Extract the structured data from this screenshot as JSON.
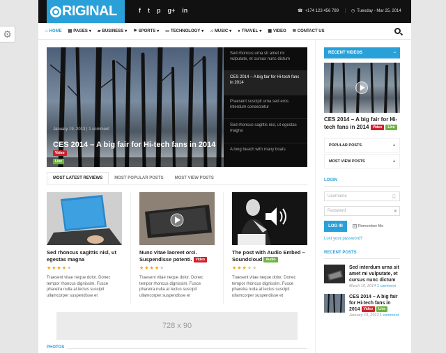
{
  "header": {
    "logo": "RIGINAL",
    "social": [
      "f",
      "t",
      "p",
      "g+",
      "in"
    ],
    "phone": "+174 123 456 789",
    "date": "Tuesday - Mar 25, 2014"
  },
  "nav": {
    "items": [
      {
        "label": "HOME",
        "icon": "home-icon"
      },
      {
        "label": "PAGES",
        "icon": "pages-icon"
      },
      {
        "label": "BUSINESS",
        "icon": "briefcase-icon"
      },
      {
        "label": "SPORTS",
        "icon": "flag-icon"
      },
      {
        "label": "TECHNOLOGY",
        "icon": "tech-icon"
      },
      {
        "label": "MUSIC",
        "icon": "music-icon"
      },
      {
        "label": "TRAVEL",
        "icon": "globe-icon"
      },
      {
        "label": "VIDEO",
        "icon": "film-icon"
      },
      {
        "label": "CONTACT US",
        "icon": "mail-icon"
      }
    ]
  },
  "hero": {
    "meta_date": "January 19, 2013",
    "meta_comments": "1 comment",
    "title": "CES 2014 – A big fair for Hi-tech fans in 2014",
    "badge_video": "Video",
    "badge_live": "Live",
    "list": [
      "Sed rhoncus urna sit amet mi vulputate, et cursus nunc dictum",
      "CES 2014 – A big fair for Hi-tech fans in 2014",
      "Praesent suscipit urna sed eros interdum consectetur",
      "Sed rhoncus sagittis nisl, ut egestas magna",
      "A long beach with many boats"
    ]
  },
  "tabs": [
    "MOST LATEST REVIEWS",
    "MOST POPULAR POSTS",
    "MOST VIEW POSTS"
  ],
  "articles": [
    {
      "title": "Sed rhoncus sagittis nisl, ut egestas magna",
      "rating": 4,
      "excerpt": "Traesent vitae neque dolor. Donec tempor rhoncus dignissim. Fusce pharetra nulla at lectus suscipit ullamcorper suspendisse et"
    },
    {
      "title": "Nunc vitae laoreet orci. Suspendisse potenti.",
      "badge": "Video",
      "rating": 4,
      "excerpt": "Traesent vitae neque dolor. Donec tempor rhoncus dignissim. Fusce pharetra nulla at lectus suscipit ullamcorper suspendisse et"
    },
    {
      "title": "The post with Audio Embed – Soundcloud",
      "badge": "Audio",
      "rating": 3,
      "excerpt": "Traesent vitae neque dolor. Donec tempor rhoncus dignissim. Fusce pharetra nulla at lectus suscipit ullamcorper suspendisse et"
    }
  ],
  "ad_label": "728 x 90",
  "bottom_heading": "PHOTOS",
  "sidebar": {
    "recent_videos_title": "RECENT VIDEOS",
    "recent_videos_toggle": "−",
    "video_title": "CES 2014 – A big fair for Hi-tech fans in 2014",
    "badge_video": "Video",
    "badge_live": "Live",
    "accordion": [
      {
        "label": "POPULAR POSTS",
        "toggle": "+"
      },
      {
        "label": "MOST VIEW POSTS",
        "toggle": "+"
      }
    ],
    "login_title": "LOGIN",
    "username_placeholder": "Username",
    "password_placeholder": "Password",
    "login_button": "LOG IN",
    "remember_label": "Remember Me",
    "lost_password": "Lost your password?",
    "recent_posts_title": "RECENT POSTS",
    "recent_posts": [
      {
        "title": "Sed interdum urna sit amet mi vulputate, et cursus nunc dictum",
        "date": "March 10, 2014",
        "comments": "1 comment"
      },
      {
        "title": "CES 2014 – A big fair for Hi-tech fans in 2014",
        "badge_video": "Video",
        "badge_live": "Live",
        "date": "January 19, 2013",
        "comments": "1 comment"
      }
    ]
  },
  "colors": {
    "accent": "#29a1d8",
    "video": "#d0202a",
    "live": "#6db33f",
    "star": "#f0a30a"
  }
}
